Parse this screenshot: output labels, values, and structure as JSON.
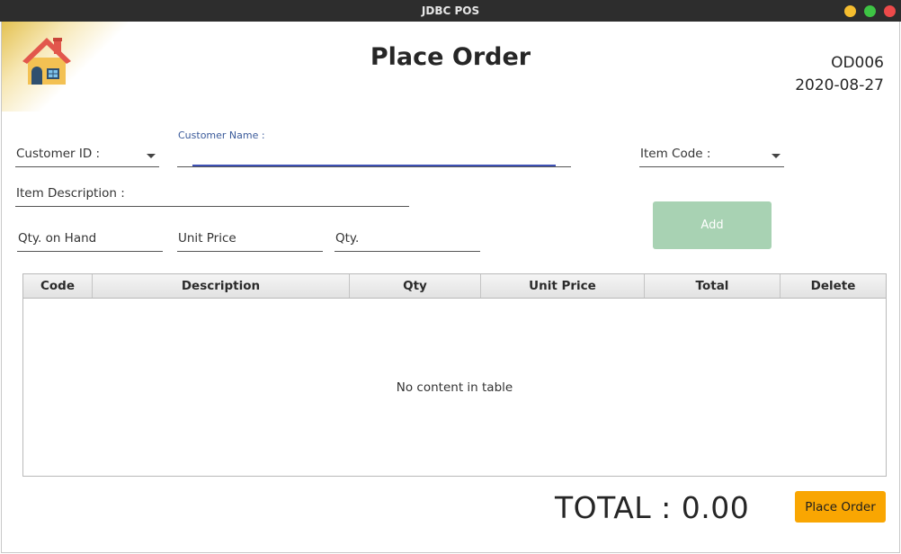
{
  "window": {
    "title": "JDBC POS"
  },
  "header": {
    "title": "Place Order",
    "order_id": "OD006",
    "date": "2020-08-27"
  },
  "form": {
    "customer_id_label": "Customer ID :",
    "customer_name_label": "Customer Name :",
    "customer_name_value": "",
    "item_code_label": "Item Code :",
    "item_description_label": "Item Description :",
    "qty_on_hand_label": "Qty. on Hand",
    "unit_price_label": "Unit Price",
    "qty_label": "Qty.",
    "add_button": "Add"
  },
  "table": {
    "columns": [
      "Code",
      "Description",
      "Qty",
      "Unit Price",
      "Total",
      "Delete"
    ],
    "placeholder": "No content in table",
    "rows": []
  },
  "footer": {
    "total_text": "TOTAL : 0.00",
    "place_order_button": "Place Order"
  },
  "colors": {
    "accent": "#3f51b5",
    "add_button": "#a8d2b3",
    "place_order_button": "#f9a602"
  },
  "icons": {
    "home": "home-icon"
  }
}
